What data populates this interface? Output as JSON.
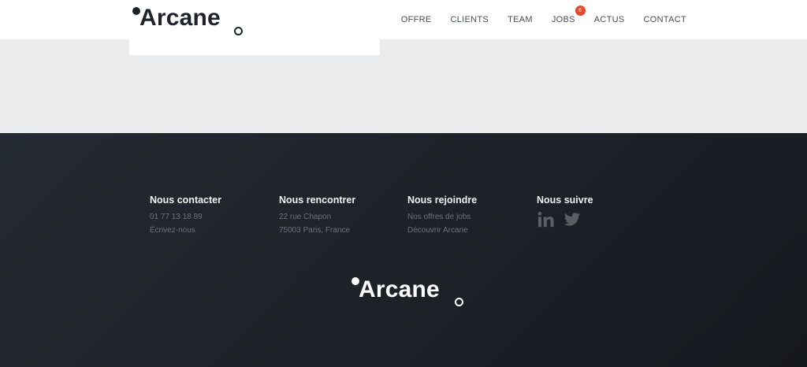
{
  "brand": {
    "name": "Arcane",
    "dark_color": "#1e232b",
    "accent_badge": "#e5492e"
  },
  "nav": {
    "items": [
      {
        "label": "OFFRE"
      },
      {
        "label": "CLIENTS"
      },
      {
        "label": "TEAM"
      },
      {
        "label": "JOBS",
        "badge": "6"
      },
      {
        "label": "ACTUS"
      },
      {
        "label": "CONTACT"
      }
    ]
  },
  "footer": {
    "columns": [
      {
        "title": "Nous contacter",
        "links": [
          "01 77 13 18 89",
          "Écrivez-nous"
        ]
      },
      {
        "title": "Nous rencontrer",
        "links": [
          "22 rue Chapon",
          "75003 Paris, France"
        ]
      },
      {
        "title": "Nous rejoindre",
        "links": [
          "Nos offres de jobs",
          "Découvrir Arcane"
        ]
      },
      {
        "title": "Nous suivre",
        "social": [
          "linkedin-icon",
          "twitter-icon"
        ]
      }
    ],
    "logo_text": "Arcane"
  }
}
